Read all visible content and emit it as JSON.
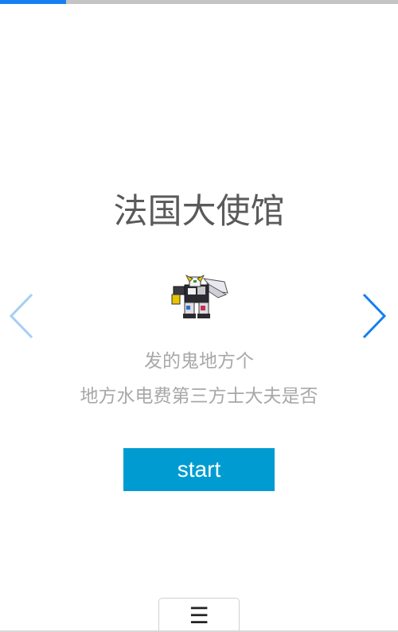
{
  "progress": {
    "fraction": 0.165,
    "fill_color": "#1580f0",
    "track_color": "#c4c4c4"
  },
  "slide": {
    "title": "法国大使馆",
    "image_icon": "robot-mecha-sprite",
    "description_lines": [
      "发的鬼地方个",
      "地方水电费第三方士大夫是否"
    ],
    "start_label": "start",
    "start_color": "#009cd1"
  },
  "navigation": {
    "prev_icon": "chevron-left-icon",
    "next_icon": "chevron-right-icon",
    "prev_color": "#a6cdf5",
    "next_color": "#1580f0"
  },
  "menu": {
    "label": "☰",
    "icon": "hamburger-menu-icon"
  }
}
